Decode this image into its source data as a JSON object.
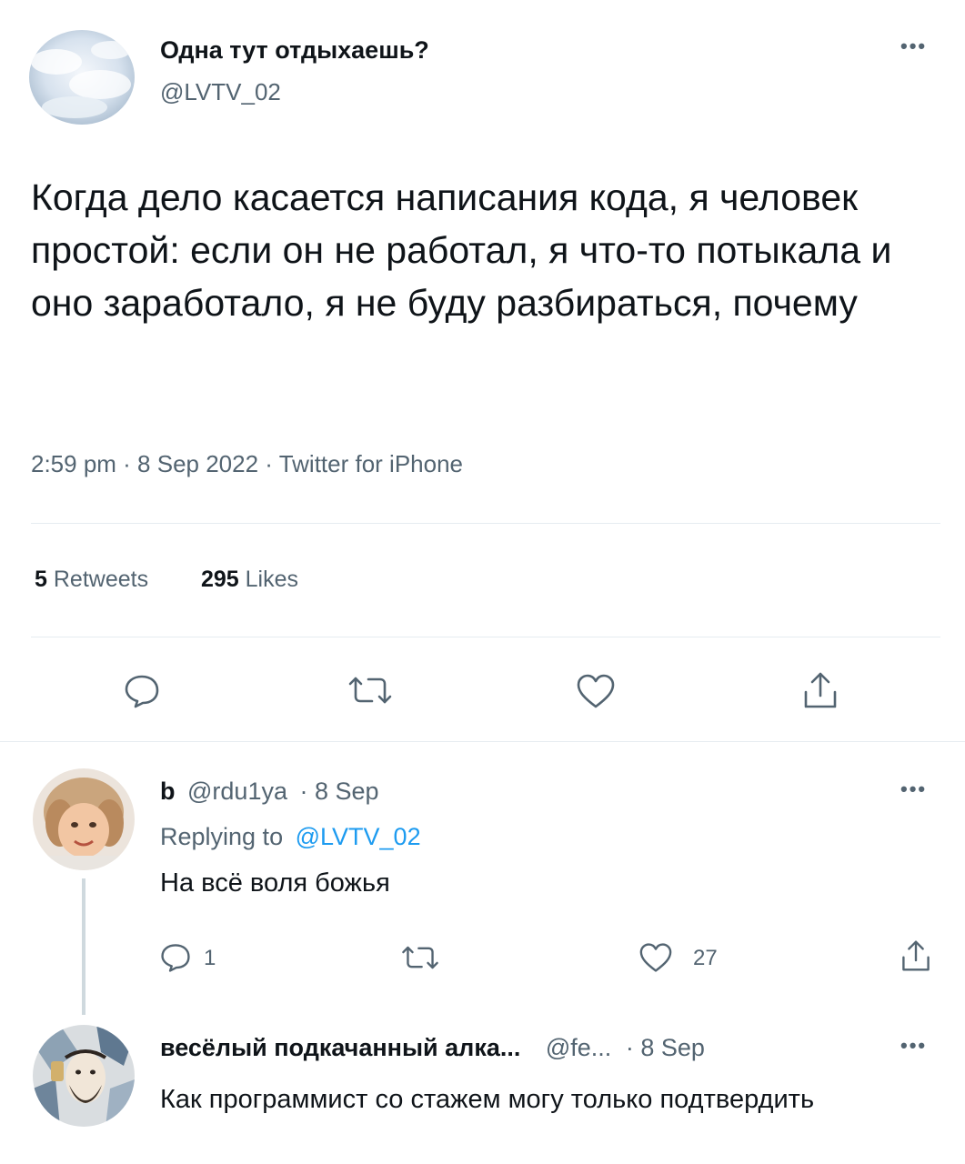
{
  "main_tweet": {
    "display_name": "Одна тут отдыхаешь?",
    "handle": "@LVTV_02",
    "text": "Когда дело касается написания кода, я человек простой: если он не работал, я что-то потыкала и оно заработало, я не буду разбираться, почему",
    "meta": "2:59 pm · 8 Sep 2022 · Twitter for iPhone",
    "retweets_count": "5",
    "retweets_label": "Retweets",
    "likes_count": "295",
    "likes_label": "Likes"
  },
  "replies": [
    {
      "display_name": "b",
      "handle": "@rdu1ya",
      "date": "· 8 Sep",
      "replying_to_label": "Replying to",
      "replying_to_handle": "@LVTV_02",
      "text": "На всё воля божья",
      "reply_count": "1",
      "retweet_count": "",
      "like_count": "27"
    },
    {
      "display_name": "весёлый подкачанный алка...",
      "handle": "@fe...",
      "date": "· 8 Sep",
      "text": "Как программист со стажем могу только подтвердить"
    }
  ],
  "icons": {
    "reply": "speech-bubble-icon",
    "retweet": "retweet-arrows-icon",
    "like": "heart-icon",
    "share": "share-upload-icon",
    "more": "more-dots-icon"
  },
  "colors": {
    "text": "#0f1419",
    "muted": "#536471",
    "link": "#1d9bf0",
    "divider": "#e6ecf0"
  }
}
